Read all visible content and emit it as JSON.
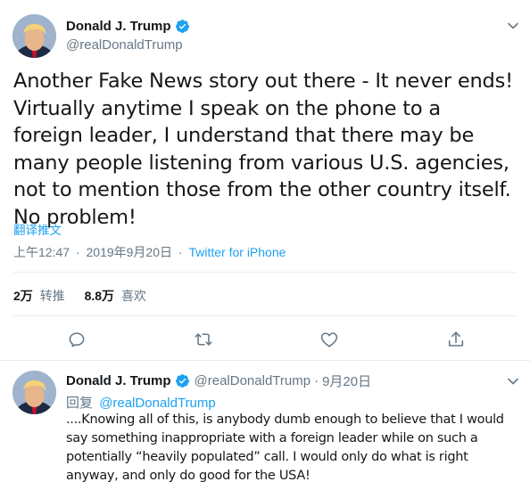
{
  "main_tweet": {
    "author": {
      "display_name": "Donald J. Trump",
      "handle": "@realDonaldTrump",
      "verified": true
    },
    "text": "Another Fake News story out there - It never ends! Virtually anytime I speak on the phone to a foreign leader, I understand that there may be many people listening from various U.S. agencies, not to mention those from the other country itself. No problem!",
    "translate_label": "翻译推文",
    "time": "上午12:47",
    "date": "2019年9月20日",
    "separator": "·",
    "source": "Twitter for iPhone",
    "stats": {
      "retweets_count": "2万",
      "retweets_label": "转推",
      "likes_count": "8.8万",
      "likes_label": "喜欢"
    }
  },
  "reply_tweet": {
    "author": {
      "display_name": "Donald J. Trump",
      "handle": "@realDonaldTrump",
      "verified": true
    },
    "separator": "·",
    "date": "9月20日",
    "reply_prefix": "回复",
    "reply_mention": "@realDonaldTrump",
    "text": "....Knowing all of this, is anybody dumb enough to believe that I would say something inappropriate with a foreign leader while on such a potentially “heavily populated” call. I would only do what is right anyway, and only do good for the USA!"
  },
  "icons": {
    "verified": "verified-badge-icon",
    "more": "chevron-down-icon",
    "reply": "reply-icon",
    "retweet": "retweet-icon",
    "like": "heart-icon",
    "share": "share-icon"
  },
  "colors": {
    "link": "#1da1f2",
    "secondary_text": "#657786",
    "primary_text": "#14171a",
    "divider": "#e6ecf0",
    "verified": "#1da1f2"
  }
}
